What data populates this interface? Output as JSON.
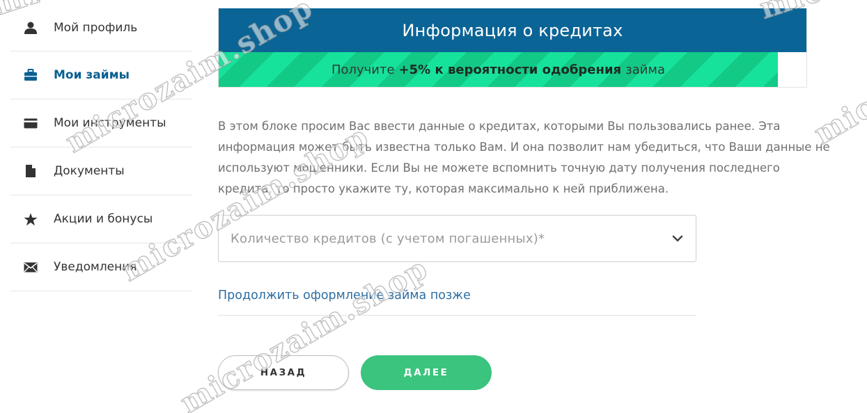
{
  "sidebar": {
    "items": [
      {
        "label": "Мой профиль",
        "icon": "user-icon"
      },
      {
        "label": "Мои займы",
        "icon": "briefcase-icon",
        "active": true
      },
      {
        "label": "Мои инструменты",
        "icon": "card-icon"
      },
      {
        "label": "Документы",
        "icon": "document-icon"
      },
      {
        "label": "Акции и бонусы",
        "icon": "star-icon"
      },
      {
        "label": "Уведомления",
        "icon": "envelope-icon"
      }
    ]
  },
  "info": {
    "title": "Информация о кредитах",
    "promo_before": "Получите",
    "promo_bold": "+5% к вероятности одобрения",
    "promo_after": "займа"
  },
  "description": "В этом блоке просим Вас ввести данные о кредитах, которыми Вы пользовались ранее. Эта информация может быть известна только Вам. И она позволит нам убедиться, что Ваши данные не используют мошенники. Если Вы не можете вспомнить точную дату получения последнего кредита, то просто укажите ту, которая максимально к ней приближена.",
  "form": {
    "credits_count_placeholder": "Количество кредитов (с учетом погашенных)*"
  },
  "continue_later_link": "Продолжить оформление займа позже",
  "buttons": {
    "back": "НАЗАД",
    "next": "ДАЛЕЕ"
  },
  "watermark": "microzaim.shop",
  "colors": {
    "header_bg": "#0b6496",
    "active_nav": "#0b5f91",
    "promo_green": "#17e29c",
    "next_button": "#3ac47d",
    "link": "#2f6ea3"
  }
}
